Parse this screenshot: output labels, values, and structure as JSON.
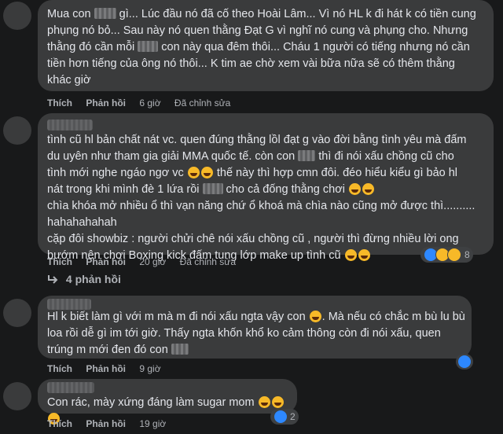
{
  "comments": [
    {
      "segments": [
        {
          "t": "Mua con "
        },
        {
          "blur": 28
        },
        {
          "t": " gì... Lúc đầu nó đã cố theo Hoài Lâm... Vì nó HL k đi hát k có tiền cung\nphụng nó bỏ... Sau này nó quen thằng Đạt G vì nghĩ nó cung và phụng cho. Nhưng\nthằng đó cần mỗi "
        },
        {
          "blur": 26
        },
        {
          "t": " con này qua đêm thôi... Cháu 1 người có tiếng nhưng nó cần\ntiền hơn tiếng của ông nó thôi... K tim ae chờ xem vài bữa nữa sẽ có thêm thằng\nkhác giờ"
        }
      ],
      "like": "Thích",
      "reply": "Phản hồi",
      "time": "6 giờ",
      "edited": "Đã chỉnh sửa"
    },
    {
      "segments": [
        {
          "t": "tình cũ hl bản chất nát vc. quen đúng thằng lồl đạt g vào đời bằng tình yêu mà đấm\ndu uyên như tham gia giải MMA quốc tế. còn con "
        },
        {
          "blur": 22
        },
        {
          "t": " thì đi nói xấu chồng cũ cho\ntình mới nghe ngáo ngơ vc "
        },
        {
          "emo": 2
        },
        {
          "t": " thế này thì hợp cmn đôi. đéo hiểu kiểu gì bảo hl\nnát trong khi mình đè 1 lứa rồi "
        },
        {
          "blur": 26
        },
        {
          "t": " cho cả đống thằng chơi "
        },
        {
          "emo": 2
        },
        {
          "t": "\nchìa khóa mở nhiều ổ thì vạn năng chứ ổ khoá mà chìa nào cũng mở được thì..........\nhahahahahah\ncặp đôi showbiz : người chửi chê nói xấu chồng cũ , người thì đừng nhiều lời ong\nbướm nên chơi Boxing kick đấm tung lớp make up tình cũ "
        },
        {
          "emo": 2
        }
      ],
      "like": "Thích",
      "reply": "Phản hồi",
      "time": "20 giờ",
      "edited": "Đã chỉnh sửa",
      "reaction_count": "8",
      "replies_toggle": "4 phản hồi"
    },
    {
      "segments": [
        {
          "t": "Hl k biết làm gì với m mà m đi nói xấu ngta vậy con "
        },
        {
          "emo": 1
        },
        {
          "t": ". Mà nếu có chắc m bù lu bù\nloa rồi dễ gì im tới giờ. Thấy ngta khốn khổ ko cảm thông còn đi nói xấu, quen\ntrúng m mới đen đó con "
        },
        {
          "blur": 22
        }
      ],
      "like": "Thích",
      "reply": "Phản hồi",
      "time": "9 giờ"
    },
    {
      "segments": [
        {
          "t": "Con rác, mày xứng đáng làm sugar mom "
        },
        {
          "emo": 3
        }
      ],
      "like": "Thích",
      "reply": "Phản hồi",
      "time": "19 giờ",
      "reaction_count": "2"
    }
  ],
  "colors": {
    "bg": "#18191a",
    "bubble": "#3a3b3c",
    "text": "#e4e6eb",
    "muted": "#b0b3b8",
    "like": "#2d88ff",
    "haha": "#f7b928"
  }
}
